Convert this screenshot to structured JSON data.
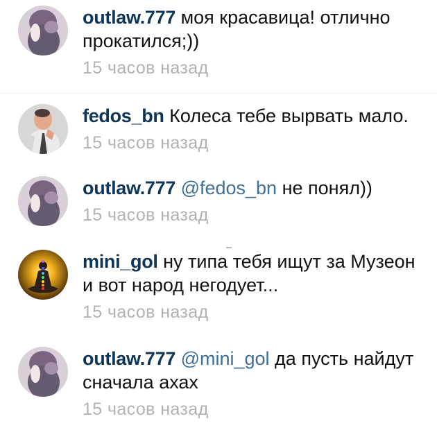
{
  "comments": [
    {
      "username": "outlaw.777",
      "mention": "",
      "text": "моя красавица! отлично прокатился;))",
      "time": "15 часов назад",
      "avatar_icon": "user-avatar-photo"
    },
    {
      "username": "fedos_bn",
      "mention": "",
      "text": "Колеса тебе вырвать мало.",
      "time": "15 часов назад",
      "avatar_icon": "user-avatar-photo"
    },
    {
      "username": "outlaw.777",
      "mention": "@fedos_bn",
      "text": "не понял))",
      "time": "15 часов назад",
      "avatar_icon": "user-avatar-photo"
    },
    {
      "username": "mini_gol",
      "mention": "",
      "text": "ну типа тебя ищут за Музеон и вот народ негодует...",
      "time": "15 часов назад",
      "avatar_icon": "meditation-chakra-avatar"
    },
    {
      "username": "outlaw.777",
      "mention": "@mini_gol",
      "text": "да пусть найдут сначала ахах",
      "time": "15 часов назад",
      "avatar_icon": "user-avatar-photo"
    }
  ],
  "colors": {
    "username": "#0f3557",
    "mention": "#3d6f98",
    "comment_text": "#111111",
    "timestamp": "#b2b2b2",
    "divider": "#efefef"
  }
}
